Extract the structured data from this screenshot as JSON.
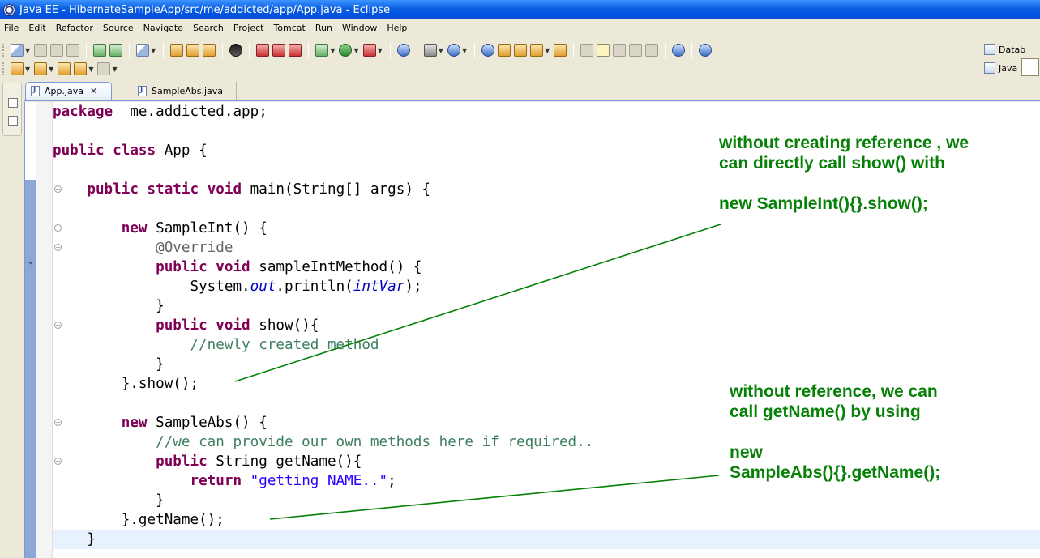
{
  "window": {
    "title": "Java EE - HibernateSampleApp/src/me/addicted/app/App.java - Eclipse"
  },
  "menu": [
    "File",
    "Edit",
    "Refactor",
    "Source",
    "Navigate",
    "Search",
    "Project",
    "Tomcat",
    "Run",
    "Window",
    "Help"
  ],
  "perspectives": {
    "database": "Datab",
    "java": "Java"
  },
  "tabs": [
    {
      "label": "App.java",
      "active": true,
      "close": "✕"
    },
    {
      "label": "SampleAbs.java",
      "active": false
    }
  ],
  "code_lines": [
    {
      "indent": "",
      "parts": [
        [
          "kw",
          "package"
        ],
        [
          "",
          "  me.addicted.app;"
        ]
      ]
    },
    {
      "indent": "",
      "parts": []
    },
    {
      "indent": "",
      "parts": [
        [
          "kw",
          "public"
        ],
        [
          "",
          " "
        ],
        [
          "kw",
          "class"
        ],
        [
          "",
          " App {"
        ]
      ]
    },
    {
      "indent": "",
      "parts": []
    },
    {
      "indent": "    ",
      "parts": [
        [
          "kw",
          "public"
        ],
        [
          "",
          " "
        ],
        [
          "kw",
          "static"
        ],
        [
          "",
          " "
        ],
        [
          "kw",
          "void"
        ],
        [
          "",
          " main(String[] args) {"
        ]
      ]
    },
    {
      "indent": "",
      "parts": []
    },
    {
      "indent": "        ",
      "parts": [
        [
          "kw",
          "new"
        ],
        [
          "",
          " SampleInt() {"
        ]
      ]
    },
    {
      "indent": "            ",
      "parts": [
        [
          "ann",
          "@Override"
        ]
      ]
    },
    {
      "indent": "            ",
      "parts": [
        [
          "kw",
          "public"
        ],
        [
          "",
          " "
        ],
        [
          "kw",
          "void"
        ],
        [
          "",
          " sampleIntMethod() {"
        ]
      ]
    },
    {
      "indent": "                ",
      "parts": [
        [
          "",
          "System."
        ],
        [
          "fld",
          "out"
        ],
        [
          "",
          ".println("
        ],
        [
          "fld",
          "intVar"
        ],
        [
          "",
          ");"
        ]
      ]
    },
    {
      "indent": "            ",
      "parts": [
        [
          "",
          "}"
        ]
      ]
    },
    {
      "indent": "            ",
      "parts": [
        [
          "kw",
          "public"
        ],
        [
          "",
          " "
        ],
        [
          "kw",
          "void"
        ],
        [
          "",
          " show(){"
        ]
      ]
    },
    {
      "indent": "                ",
      "parts": [
        [
          "cm",
          "//newly created method"
        ]
      ]
    },
    {
      "indent": "            ",
      "parts": [
        [
          "",
          "}"
        ]
      ]
    },
    {
      "indent": "        ",
      "parts": [
        [
          "",
          "}.show();"
        ]
      ]
    },
    {
      "indent": "",
      "parts": []
    },
    {
      "indent": "        ",
      "parts": [
        [
          "kw",
          "new"
        ],
        [
          "",
          " SampleAbs() {"
        ]
      ]
    },
    {
      "indent": "            ",
      "parts": [
        [
          "cm",
          "//we can provide our own methods here if required.."
        ]
      ]
    },
    {
      "indent": "            ",
      "parts": [
        [
          "kw",
          "public"
        ],
        [
          "",
          " String getName(){"
        ]
      ]
    },
    {
      "indent": "                ",
      "parts": [
        [
          "kw",
          "return"
        ],
        [
          "",
          " "
        ],
        [
          "str",
          "\"getting NAME..\""
        ],
        [
          "",
          ";"
        ]
      ]
    },
    {
      "indent": "            ",
      "parts": [
        [
          "",
          "}"
        ]
      ]
    },
    {
      "indent": "        ",
      "parts": [
        [
          "",
          "}.getName();"
        ]
      ]
    },
    {
      "indent": "    ",
      "parts": [
        [
          "",
          "}"
        ]
      ]
    }
  ],
  "annotations": {
    "first": {
      "line1": "without creating reference , we",
      "line2": "can directly call show() with",
      "line3": "new SampleInt(){}.show();"
    },
    "second": {
      "line1": "without reference, we can",
      "line2": "call getName() by using",
      "line3": "new",
      "line4": "SampleAbs(){}.getName();"
    }
  },
  "colors": {
    "keyword": "#7f0055",
    "comment": "#3f7f5f",
    "string": "#2a00ff",
    "annotation_text": "#068006"
  }
}
